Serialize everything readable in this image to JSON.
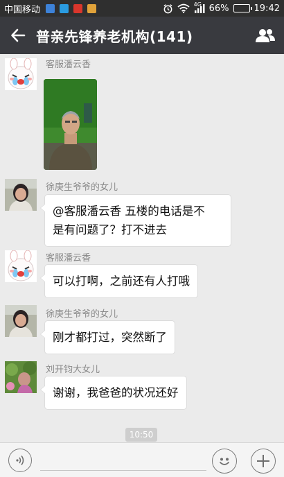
{
  "status_bar": {
    "carrier": "中国移动",
    "network_type": "4G",
    "battery": "66%",
    "battery_level": 0.66,
    "time": "19:42"
  },
  "header": {
    "title": "普亲先锋养老机构(141)",
    "back_icon": "arrow-left-icon",
    "members_icon": "group-members-icon"
  },
  "messages": [
    {
      "sender": "客服潘云香",
      "type": "image",
      "avatar": "cartoon-bunny-avatar"
    },
    {
      "sender": "徐庚生爷爷的女儿",
      "type": "text",
      "lines": [
        "@客服潘云香 五楼的电话是不",
        "是有问题了？打不进去"
      ],
      "avatar": "woman-photo-avatar"
    },
    {
      "sender": "客服潘云香",
      "type": "text",
      "lines": [
        "可以打啊，之前还有人打哦"
      ],
      "avatar": "cartoon-bunny-avatar"
    },
    {
      "sender": "徐庚生爷爷的女儿",
      "type": "text",
      "lines": [
        "刚才都打过，突然断了"
      ],
      "avatar": "woman-photo-avatar"
    },
    {
      "sender": "刘开钧大女儿",
      "type": "text",
      "lines": [
        "谢谢，我爸爸的状况还好"
      ],
      "avatar": "garden-photo-avatar"
    }
  ],
  "timestamp": "10:50",
  "input_bar": {
    "placeholder": "",
    "voice_icon": "voice-icon",
    "emoji_icon": "emoji-icon",
    "plus_icon": "plus-icon"
  },
  "colors": {
    "title_bar": "#393a3f",
    "status_bar": "#2f2f2f",
    "chat_bg": "#ebebeb",
    "bubble": "#ffffff"
  }
}
